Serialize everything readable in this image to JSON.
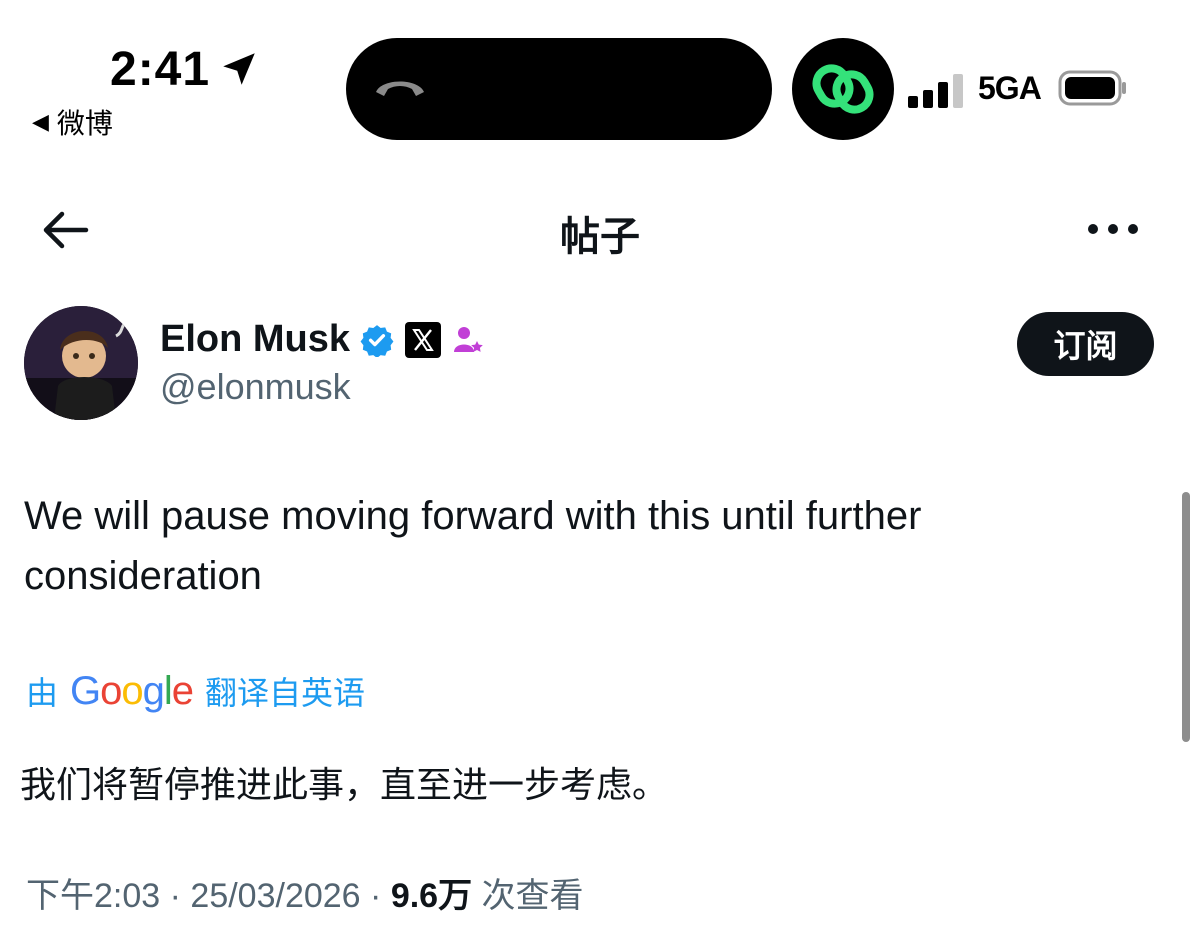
{
  "status_bar": {
    "time": "2:41",
    "back_app": "微博",
    "network": "5GA"
  },
  "header": {
    "title": "帖子"
  },
  "profile": {
    "name": "Elon Musk",
    "handle": "@elonmusk",
    "subscribe_label": "订阅"
  },
  "tweet": {
    "text": "We will pause moving forward with this until further consideration"
  },
  "translation": {
    "prefix": "由",
    "provider": "Google",
    "suffix": "翻译自英语",
    "text": "我们将暂停推进此事，直至进一步考虑。"
  },
  "meta": {
    "time": "下午2:03",
    "date": "25/03/2026",
    "views": "9.6万",
    "views_label": "次查看",
    "separator": "·"
  },
  "colors": {
    "verified_blue": "#1d9bf0",
    "subscribe_bg": "#0f1419",
    "secondary_text": "#536471",
    "link_blue": "#1d9bf0",
    "phone_icon_green": "#34e27a"
  },
  "icons": [
    "location-arrow-icon",
    "phone-hangup-icon",
    "link-icon",
    "signal-icon",
    "battery-icon",
    "back-arrow-icon",
    "more-icon",
    "verified-badge-icon",
    "x-logo-icon",
    "affiliate-icon"
  ]
}
